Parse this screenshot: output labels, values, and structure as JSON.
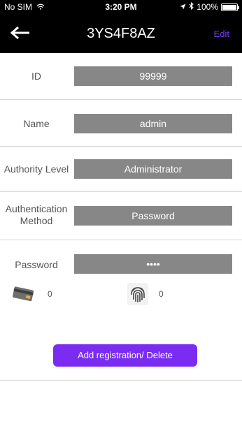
{
  "status_bar": {
    "carrier": "No SIM",
    "time": "3:20 PM",
    "battery": "100%",
    "icons": [
      "wifi-icon",
      "location-arrow-icon",
      "bluetooth-icon",
      "battery-icon"
    ]
  },
  "nav": {
    "title": "3YS4F8AZ",
    "edit_label": "Edit",
    "back_icon": "arrow-left-icon",
    "accent_color": "#7a3cff"
  },
  "fields": {
    "id": {
      "label": "ID",
      "value": "99999"
    },
    "name": {
      "label": "Name",
      "value": "admin"
    },
    "authority_level": {
      "label": "Authority Level",
      "value": "Administrator"
    },
    "authentication_method": {
      "label_line1": "Authentication",
      "label_line2": "Method",
      "value": "Password"
    },
    "password": {
      "label": "Password",
      "value": "••••"
    }
  },
  "credentials": {
    "card_count": "0",
    "fingerprint_count": "0",
    "card_icon": "card-icon",
    "fingerprint_icon": "fingerprint-icon"
  },
  "actions": {
    "add_delete_label": "Add registration/ Delete",
    "button_color": "#7a2df0"
  }
}
